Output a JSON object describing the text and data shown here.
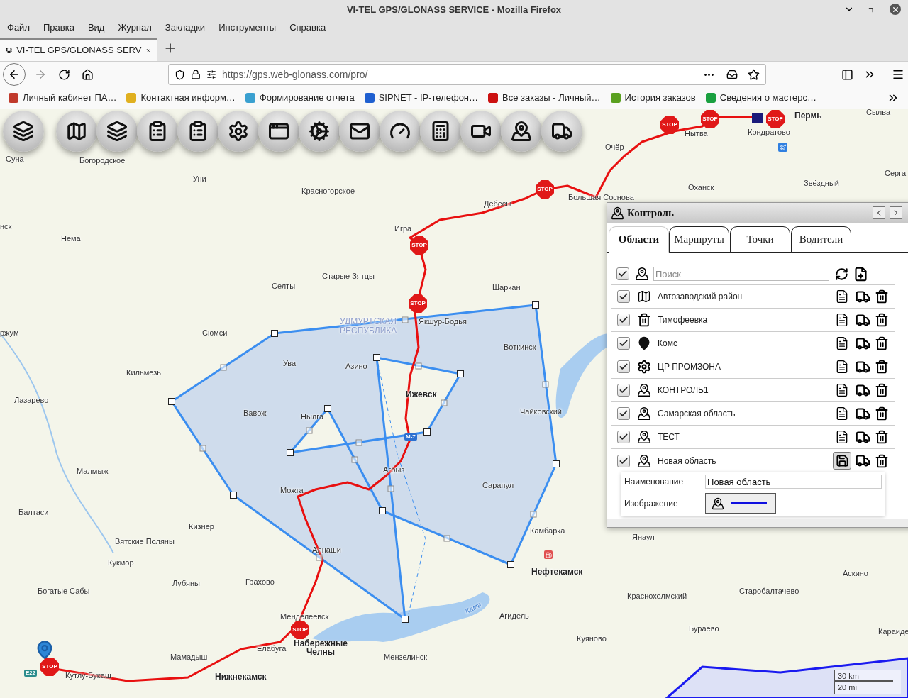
{
  "window": {
    "title": "VI-TEL GPS/GLONASS SERVICE - Mozilla Firefox"
  },
  "menu": [
    "Файл",
    "Правка",
    "Вид",
    "Журнал",
    "Закладки",
    "Инструменты",
    "Справка"
  ],
  "tabs": [
    {
      "label": "VI-TEL GPS/GLONASS SERV",
      "selected": true
    }
  ],
  "address_bar": {
    "url": "https://gps.web-glonass.com/pro/"
  },
  "bookmarks": [
    "Личный кабинет ПА…",
    "Контактная информ…",
    "Формирование отчета",
    "SIPNET - IP-телефон…",
    "Все заказы - Личный…",
    "История заказов",
    "Сведения о мастерс…"
  ],
  "map": {
    "labels": [
      {
        "text": "Суна",
        "kind": "town"
      },
      {
        "text": "Богородское",
        "kind": "town"
      },
      {
        "text": "Уни",
        "kind": "town"
      },
      {
        "text": "Красногорское",
        "kind": "town"
      },
      {
        "text": "нск",
        "kind": "town"
      },
      {
        "text": "Нема",
        "kind": "town"
      },
      {
        "text": "Игра",
        "kind": "town"
      },
      {
        "text": "Старые Зятцы",
        "kind": "town"
      },
      {
        "text": "Селты",
        "kind": "town"
      },
      {
        "text": "Шаркан",
        "kind": "town"
      },
      {
        "text": "Якшур-Бодья",
        "kind": "town"
      },
      {
        "text": "УДМУРТСКАЯ РЕСПУБЛИКА",
        "kind": "region"
      },
      {
        "text": "ржум",
        "kind": "town"
      },
      {
        "text": "Сюмси",
        "kind": "town"
      },
      {
        "text": "Кильмезь",
        "kind": "town"
      },
      {
        "text": "Ува",
        "kind": "town"
      },
      {
        "text": "Азино",
        "kind": "town"
      },
      {
        "text": "Воткинск",
        "kind": "town"
      },
      {
        "text": "Лазарево",
        "kind": "town"
      },
      {
        "text": "Ижевск",
        "kind": "city"
      },
      {
        "text": "Вавож",
        "kind": "town"
      },
      {
        "text": "Нылга",
        "kind": "town"
      },
      {
        "text": "Чайковский",
        "kind": "town"
      },
      {
        "text": "Малмыж",
        "kind": "town"
      },
      {
        "text": "Агрыз",
        "kind": "town"
      },
      {
        "text": "Сарапул",
        "kind": "town"
      },
      {
        "text": "Можга",
        "kind": "town"
      },
      {
        "text": "Балтаси",
        "kind": "town"
      },
      {
        "text": "Кизнер",
        "kind": "town"
      },
      {
        "text": "Камбарка",
        "kind": "town"
      },
      {
        "text": "Янаул",
        "kind": "town"
      },
      {
        "text": "Вятские Поляны",
        "kind": "town"
      },
      {
        "text": "Алнаши",
        "kind": "town"
      },
      {
        "text": "Кукмор",
        "kind": "town"
      },
      {
        "text": "Нефтекамск",
        "kind": "city"
      },
      {
        "text": "Аскино",
        "kind": "town"
      },
      {
        "text": "Лубяны",
        "kind": "town"
      },
      {
        "text": "Грахово",
        "kind": "town"
      },
      {
        "text": "Богатые Сабы",
        "kind": "town"
      },
      {
        "text": "Старобалтачево",
        "kind": "town"
      },
      {
        "text": "Краснохолмский",
        "kind": "town"
      },
      {
        "text": "Кама",
        "kind": "river"
      },
      {
        "text": "Агидель",
        "kind": "town"
      },
      {
        "text": "Менделеевск",
        "kind": "town"
      },
      {
        "text": "Бураево",
        "kind": "town"
      },
      {
        "text": "Караиде",
        "kind": "town"
      },
      {
        "text": "Куяново",
        "kind": "town"
      },
      {
        "text": "Елабуга",
        "kind": "town"
      },
      {
        "text": "Набережные Челны",
        "kind": "city"
      },
      {
        "text": "Мамадыш",
        "kind": "town"
      },
      {
        "text": "Мензелинск",
        "kind": "town"
      },
      {
        "text": "Кутлу-Букаш",
        "kind": "town"
      },
      {
        "text": "Нижнекамск",
        "kind": "city"
      },
      {
        "text": "Очёр",
        "kind": "town"
      },
      {
        "text": "Нытва",
        "kind": "town"
      },
      {
        "text": "Пермь",
        "kind": "city"
      },
      {
        "text": "Кондратово",
        "kind": "town"
      },
      {
        "text": "Сылва",
        "kind": "town"
      },
      {
        "text": "Серга",
        "kind": "town"
      },
      {
        "text": "Оханск",
        "kind": "town"
      },
      {
        "text": "Звёздный",
        "kind": "town"
      },
      {
        "text": "Дебёсы",
        "kind": "town"
      },
      {
        "text": "Большая Соснова",
        "kind": "town"
      }
    ],
    "stop_markers": [
      "STOP",
      "STOP",
      "STOP",
      "STOP",
      "STOP",
      "STOP",
      "STOP",
      "STOP"
    ],
    "road_badges": [
      "E22",
      "M-7"
    ],
    "scale": [
      "30 km",
      "20 mi"
    ]
  },
  "panel": {
    "title": "Контроль",
    "tabs": [
      {
        "label": "Области",
        "selected": true
      },
      {
        "label": "Маршруты",
        "selected": false
      },
      {
        "label": "Точки",
        "selected": false
      },
      {
        "label": "Водители",
        "selected": false
      }
    ],
    "search": {
      "placeholder": "Поиск",
      "checked": true
    },
    "rows": [
      {
        "name": "Автозаводский район",
        "kind": "area",
        "checked": true,
        "editing": false
      },
      {
        "name": "Тимофеевка",
        "kind": "trash",
        "checked": true,
        "editing": false
      },
      {
        "name": "Комс",
        "kind": "point",
        "checked": true,
        "editing": false
      },
      {
        "name": "ЦР ПРОМЗОНА",
        "kind": "gear",
        "checked": true,
        "editing": false
      },
      {
        "name": "КОНТРОЛЬ1",
        "kind": "zone",
        "checked": true,
        "editing": false
      },
      {
        "name": "Самарская область",
        "kind": "zone",
        "checked": true,
        "editing": false
      },
      {
        "name": "ТЕСТ",
        "kind": "zone",
        "checked": true,
        "editing": false
      },
      {
        "name": "Новая область",
        "kind": "zone",
        "checked": true,
        "editing": true
      }
    ],
    "details": {
      "name_label": "Наименование",
      "name_value": "Новая область",
      "image_label": "Изображение"
    }
  }
}
